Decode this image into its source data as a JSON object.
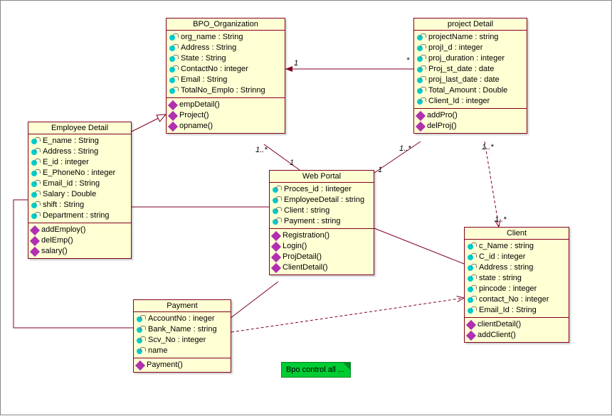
{
  "chart_data": {
    "type": "uml_class_diagram",
    "classes": [
      {
        "id": "bpo",
        "name": "BPO_Organization",
        "attributes": [
          "org_name : String",
          "Address : String",
          "State : String",
          "ContactNo : integer",
          "Email : String",
          "TotalNo_Emplo : Strinng"
        ],
        "operations": [
          "empDetail()",
          "Project()",
          "opname()"
        ]
      },
      {
        "id": "project",
        "name": "project Detail",
        "attributes": [
          "projectName : string",
          "projI_d : integer",
          "proj_duration : integer",
          "Proj_st_date : date",
          "proj_last_date : date",
          "Total_Amount : Double",
          "Client_Id : integer"
        ],
        "operations": [
          "addPro()",
          "delProj()"
        ]
      },
      {
        "id": "employee",
        "name": "Employee Detail",
        "attributes": [
          "E_name : String",
          "Address : String",
          "E_id : integer",
          "E_PhoneNo : integer",
          "Email_id : String",
          "Salary : Double",
          "shift : String",
          "Department : string"
        ],
        "operations": [
          "addEmploy()",
          "delEmp()",
          "salary()"
        ]
      },
      {
        "id": "webportal",
        "name": "Web Portal",
        "attributes": [
          "Proces_id : Iinteger",
          "EmployeeDetail : string",
          "Client : string",
          "Payment : string"
        ],
        "operations": [
          "Registration()",
          "Login()",
          "ProjDetail()",
          "ClientDetail()"
        ]
      },
      {
        "id": "client",
        "name": "Client",
        "attributes": [
          "c_Name : string",
          "C_id : integer",
          "Address : string",
          "state : string",
          "pincode : integer",
          "contact_No : integer",
          "Email_Id : String"
        ],
        "operations": [
          "clientDetail()",
          "addClient()"
        ]
      },
      {
        "id": "payment",
        "name": "Payment",
        "attributes": [
          "AccountNo : ineger",
          "Bank_Name : string",
          "Scv_No : integer",
          "name"
        ],
        "operations": [
          "Payment()"
        ]
      }
    ],
    "note": "Bpo control all ...",
    "relationships": [
      {
        "from": "project",
        "to": "bpo",
        "type": "navigable",
        "mult_from": "*",
        "mult_to": "1"
      },
      {
        "from": "employee",
        "to": "bpo",
        "type": "generalization"
      },
      {
        "from": "bpo",
        "to": "webportal",
        "type": "association",
        "mult_from": "1..*",
        "mult_to": "1"
      },
      {
        "from": "project",
        "to": "webportal",
        "type": "association",
        "mult_from": "1..*",
        "mult_to": "1"
      },
      {
        "from": "project",
        "to": "client",
        "type": "dependency",
        "mult_to": "1..*"
      },
      {
        "from": "employee",
        "to": "webportal",
        "type": "association"
      },
      {
        "from": "payment",
        "to": "webportal",
        "type": "association"
      },
      {
        "from": "client",
        "to": "webportal",
        "type": "association"
      },
      {
        "from": "payment",
        "to": "client",
        "type": "dependency"
      },
      {
        "from": "payment",
        "to": "employee",
        "type": "association"
      }
    ]
  },
  "classes": {
    "bpo": {
      "title": "BPO_Organization",
      "attrs": [
        "org_name : String",
        "Address : String",
        "State : String",
        "ContactNo : integer",
        "Email : String",
        "TotalNo_Emplo : Strinng"
      ],
      "ops": [
        "empDetail()",
        "Project()",
        "opname()"
      ]
    },
    "project": {
      "title": "project Detail",
      "attrs": [
        "projectName : string",
        "projI_d : integer",
        "proj_duration : integer",
        "Proj_st_date : date",
        "proj_last_date : date",
        "Total_Amount : Double",
        "Client_Id : integer"
      ],
      "ops": [
        "addPro()",
        "delProj()"
      ]
    },
    "employee": {
      "title": "Employee Detail",
      "attrs": [
        "E_name : String",
        "Address : String",
        "E_id : integer",
        "E_PhoneNo : integer",
        "Email_id : String",
        "Salary : Double",
        "shift : String",
        "Department : string"
      ],
      "ops": [
        "addEmploy()",
        "delEmp()",
        "salary()"
      ]
    },
    "webportal": {
      "title": "Web Portal",
      "attrs": [
        "Proces_id : Iinteger",
        "EmployeeDetail : string",
        "Client : string",
        "Payment : string"
      ],
      "ops": [
        "Registration()",
        "Login()",
        "ProjDetail()",
        "ClientDetail()"
      ]
    },
    "client": {
      "title": "Client",
      "attrs": [
        "c_Name : string",
        "C_id : integer",
        "Address : string",
        "state : string",
        "pincode : integer",
        "contact_No : integer",
        "Email_Id : String"
      ],
      "ops": [
        "clientDetail()",
        "addClient()"
      ]
    },
    "payment": {
      "title": "Payment",
      "attrs": [
        "AccountNo : ineger",
        "Bank_Name : string",
        "Scv_No : integer",
        "name"
      ],
      "ops": [
        "Payment()"
      ]
    }
  },
  "note_text": "Bpo control all ...",
  "mults": {
    "m_proj_star": "*",
    "m_bpo_one": "1",
    "m_bpo_1s": "1..*",
    "m_wp_1a": "1",
    "m_proj_1s": "1..*",
    "m_wp_1b": "1",
    "m_proj_1s2": "1..*",
    "m_cli_1s": "1..*"
  }
}
